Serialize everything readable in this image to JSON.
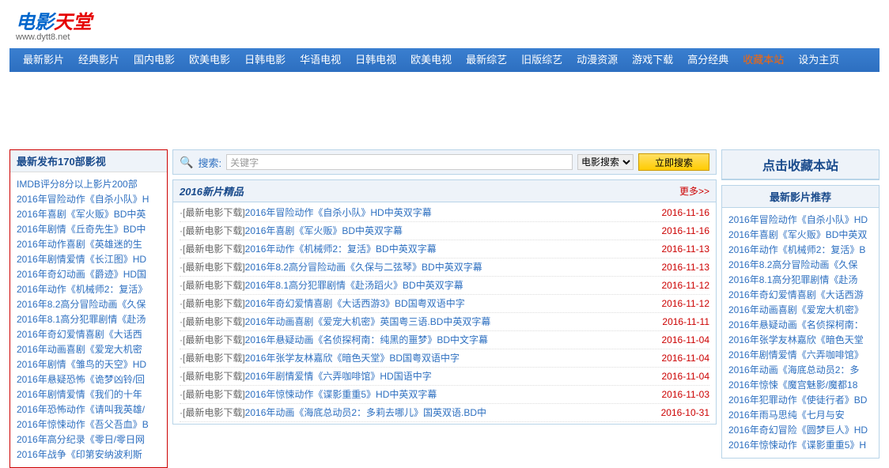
{
  "logo": {
    "text1": "电影",
    "text2": "天堂",
    "url": "www.dytt8.net"
  },
  "nav": [
    "最新影片",
    "经典影片",
    "国内电影",
    "欧美电影",
    "日韩电影",
    "华语电视",
    "日韩电视",
    "欧美电视",
    "最新综艺",
    "旧版综艺",
    "动漫资源",
    "游戏下载",
    "高分经典",
    "收藏本站",
    "设为主页"
  ],
  "left": {
    "title": "最新发布170部影视",
    "items": [
      "IMDB评分8分以上影片200部",
      "2016年冒险动作《自杀小队》H",
      "2016年喜剧《军火贩》BD中英",
      "2016年剧情《丘奇先生》BD中",
      "2016年动作喜剧《英雄迷的生",
      "2016年剧情爱情《长江图》HD",
      "2016年奇幻动画《爵迹》HD国",
      "2016年动作《机械师2：复活》",
      "2016年8.2高分冒险动画《久保",
      "2016年8.1高分犯罪剧情《赴汤",
      "2016年奇幻爱情喜剧《大话西",
      "2016年动画喜剧《爱宠大机密",
      "2016年剧情《雏鸟的天空》HD",
      "2016年悬疑恐怖《诡梦凶铃/回",
      "2016年剧情爱情《我们的十年",
      "2016年恐怖动作《请叫我英雄/",
      "2016年惊悚动作《吾父吾血》B",
      "2016年高分纪录《零日/零日网",
      "2016年战争《印第安纳波利斯"
    ]
  },
  "search": {
    "label": "搜索:",
    "placeholder": "关键字",
    "select": "电影搜索",
    "button": "立即搜索"
  },
  "mid": {
    "title": "2016新片精品",
    "more": "更多>>",
    "cat": "[最新电影下载]",
    "rows": [
      {
        "t": "2016年冒险动作《自杀小队》HD中英双字幕",
        "d": "2016-11-16"
      },
      {
        "t": "2016年喜剧《军火贩》BD中英双字幕",
        "d": "2016-11-16"
      },
      {
        "t": "2016年动作《机械师2：复活》BD中英双字幕",
        "d": "2016-11-13"
      },
      {
        "t": "2016年8.2高分冒险动画《久保与二弦琴》BD中英双字幕",
        "d": "2016-11-13"
      },
      {
        "t": "2016年8.1高分犯罪剧情《赴汤蹈火》BD中英双字幕",
        "d": "2016-11-12"
      },
      {
        "t": "2016年奇幻爱情喜剧《大话西游3》BD国粤双语中字",
        "d": "2016-11-12"
      },
      {
        "t": "2016年动画喜剧《爱宠大机密》英国粤三语.BD中英双字幕",
        "d": "2016-11-11"
      },
      {
        "t": "2016年悬疑动画《名侦探柯南：纯黑的噩梦》BD中文字幕",
        "d": "2016-11-04"
      },
      {
        "t": "2016年张学友林嘉欣《暗色天堂》BD国粤双语中字",
        "d": "2016-11-04"
      },
      {
        "t": "2016年剧情爱情《六弄咖啡馆》HD国语中字",
        "d": "2016-11-04"
      },
      {
        "t": "2016年惊悚动作《谍影重重5》HD中英双字幕",
        "d": "2016-11-03"
      },
      {
        "t": "2016年动画《海底总动员2：多莉去哪儿》国英双语.BD中",
        "d": "2016-10-31"
      }
    ]
  },
  "right": {
    "fav": "点击收藏本站",
    "rec_title": "最新影片推荐",
    "rec_items": [
      "2016年冒险动作《自杀小队》HD",
      "2016年喜剧《军火贩》BD中英双",
      "2016年动作《机械师2：复活》B",
      "2016年8.2高分冒险动画《久保",
      "2016年8.1高分犯罪剧情《赴汤",
      "2016年奇幻爱情喜剧《大话西游",
      "2016年动画喜剧《爱宠大机密》",
      "2016年悬疑动画《名侦探柯南：",
      "2016年张学友林嘉欣《暗色天堂",
      "2016年剧情爱情《六弄咖啡馆》",
      "2016年动画《海底总动员2：多",
      "2016年惊悚《魔宫魅影/魔都18",
      "2016年犯罪动作《使徒行者》BD",
      "2016年雨马思纯《七月与安",
      "2016年奇幻冒险《圆梦巨人》HD",
      "2016年惊悚动作《谍影重重5》H"
    ]
  }
}
